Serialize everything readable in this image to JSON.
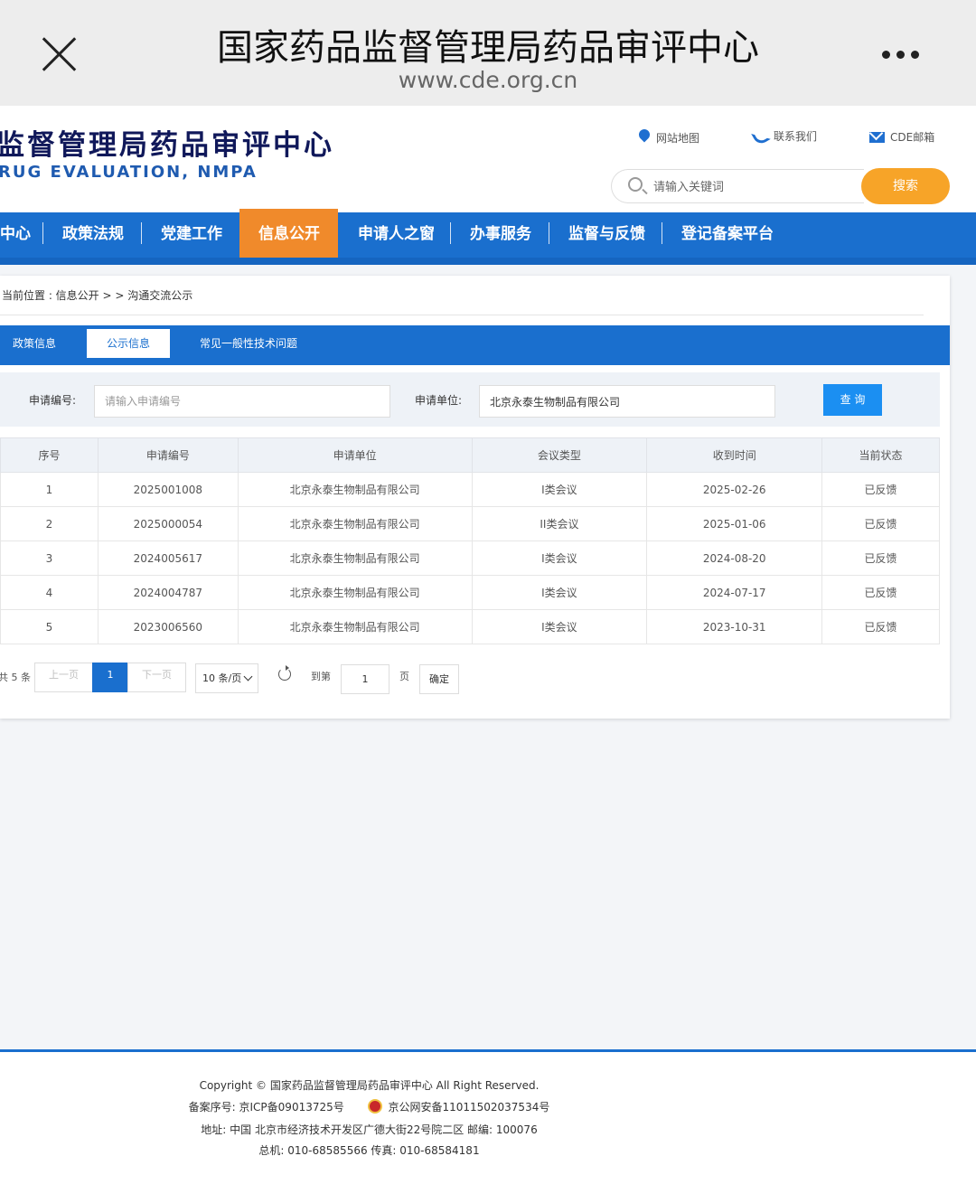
{
  "browser": {
    "title": "国家药品监督管理局药品审评中心",
    "url": "www.cde.org.cn"
  },
  "header": {
    "logo_cn": "监督管理局药品审评中心",
    "logo_en": "RUG EVALUATION, NMPA",
    "links": {
      "sitemap": "网站地图",
      "contact": "联系我们",
      "mail": "CDE邮箱"
    },
    "search_placeholder": "请输入关键词",
    "search_button": "搜索"
  },
  "nav": {
    "items": [
      "中心",
      "政策法规",
      "党建工作",
      "信息公开",
      "申请人之窗",
      "办事服务",
      "监督与反馈",
      "登记备案平台"
    ],
    "active": "信息公开"
  },
  "breadcrumb": "当前位置 : 信息公开 > > 沟通交流公示",
  "tabs": [
    "政策信息",
    "公示信息",
    "常见一般性技术问题"
  ],
  "filter": {
    "app_no_label": "申请编号:",
    "app_no_placeholder": "请输入申请编号",
    "applicant_label": "申请单位:",
    "applicant_value": "北京永泰生物制品有限公司",
    "query_button": "查 询"
  },
  "table": {
    "headers": [
      "序号",
      "申请编号",
      "申请单位",
      "会议类型",
      "收到时间",
      "当前状态"
    ],
    "rows": [
      [
        "1",
        "2025001008",
        "北京永泰生物制品有限公司",
        "I类会议",
        "2025-02-26",
        "已反馈"
      ],
      [
        "2",
        "2025000054",
        "北京永泰生物制品有限公司",
        "II类会议",
        "2025-01-06",
        "已反馈"
      ],
      [
        "3",
        "2024005617",
        "北京永泰生物制品有限公司",
        "I类会议",
        "2024-08-20",
        "已反馈"
      ],
      [
        "4",
        "2024004787",
        "北京永泰生物制品有限公司",
        "I类会议",
        "2024-07-17",
        "已反馈"
      ],
      [
        "5",
        "2023006560",
        "北京永泰生物制品有限公司",
        "I类会议",
        "2023-10-31",
        "已反馈"
      ]
    ]
  },
  "pager": {
    "total": "共 5 条",
    "prev": "上一页",
    "current": "1",
    "next": "下一页",
    "page_size": "10 条/页",
    "goto": "到第",
    "goto_value": "1",
    "page_suffix": "页",
    "confirm": "确定"
  },
  "footer": {
    "copyright": "Copyright © 国家药品监督管理局药品审评中心   All Right Reserved.",
    "icp": "备案序号:  京ICP备09013725号",
    "police": "京公网安备11011502037534号",
    "address": "地址:  中国 北京市经济技术开发区广德大街22号院二区        邮编:  100076",
    "phone": "总机:  010-68585566        传真:  010-68584181"
  }
}
